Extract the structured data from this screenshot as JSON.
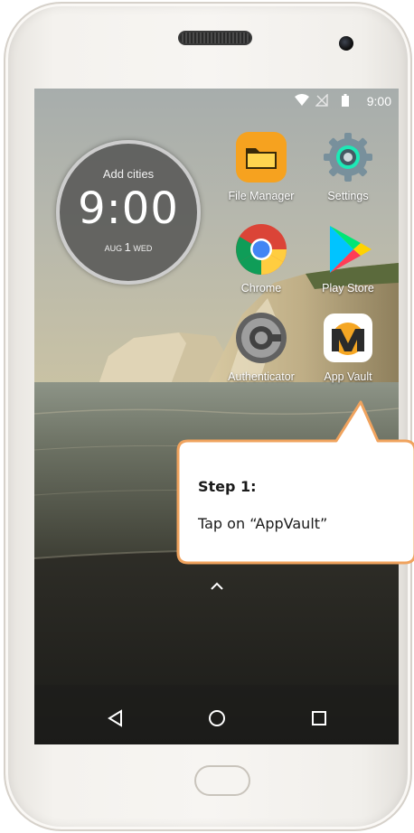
{
  "status_bar": {
    "time": "9:00",
    "icons": [
      "wifi-icon",
      "no-sim-icon",
      "battery-icon"
    ]
  },
  "clock_widget": {
    "cities_label": "Add cities",
    "time": "9:00",
    "month": "AUG",
    "day": "1",
    "weekday": "WED"
  },
  "apps": [
    {
      "name": "File Manager",
      "icon": "folder-icon"
    },
    {
      "name": "Settings",
      "icon": "gear-icon"
    },
    {
      "name": "Chrome",
      "icon": "chrome-icon"
    },
    {
      "name": "Play Store",
      "icon": "play-store-icon"
    },
    {
      "name": "Authenticator",
      "icon": "authenticator-icon"
    },
    {
      "name": "App Vault",
      "icon": "app-vault-icon"
    }
  ],
  "nav_bar": {
    "buttons": [
      "back-icon",
      "home-icon",
      "recents-icon"
    ]
  },
  "callout": {
    "title": "Step 1:",
    "body": "Tap on “AppVault”",
    "border_color": "#f0a35e"
  }
}
